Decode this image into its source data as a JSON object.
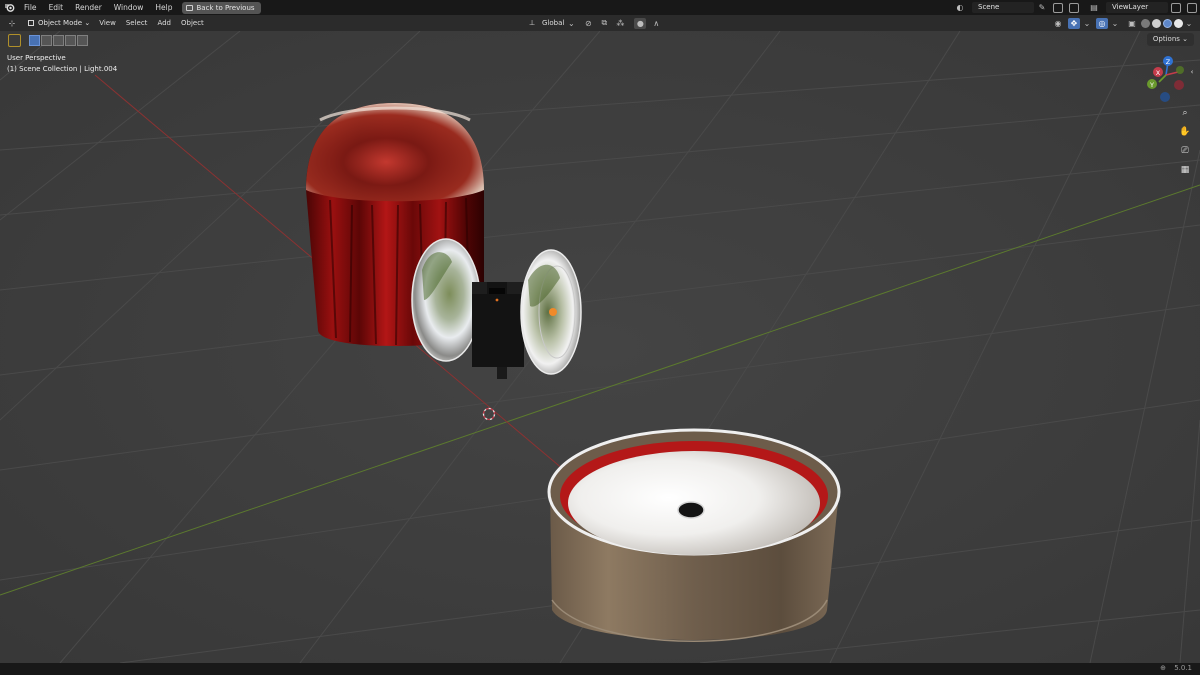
{
  "menu": {
    "file": "File",
    "edit": "Edit",
    "render": "Render",
    "window": "Window",
    "help": "Help",
    "back_to_previous": "Back to Previous"
  },
  "topbar_right": {
    "scene": "Scene",
    "view_layer": "ViewLayer"
  },
  "header": {
    "mode": "Object Mode",
    "view": "View",
    "select": "Select",
    "add": "Add",
    "object": "Object",
    "transform_orientation": "Global",
    "options": "Options"
  },
  "viewport": {
    "perspective_label": "User Perspective",
    "collection_label": "(1) Scene Collection | Light.004",
    "gizmo_axes": {
      "x": "X",
      "y": "Y",
      "z": "Z"
    }
  },
  "status": {
    "version": "5.0.1"
  },
  "icons": [
    "blender-logo",
    "editor-type-icon",
    "object-mode-icon",
    "transform-orientation-icon",
    "snap-icon",
    "proportional-editing-icon",
    "visibility-icon",
    "gizmo-icon",
    "overlay-icon",
    "xray-icon",
    "wireframe-shading-icon",
    "solid-shading-icon",
    "material-shading-icon",
    "rendered-shading-icon",
    "zoom-icon",
    "pan-hand-icon",
    "camera-view-icon",
    "grid-ortho-icon",
    "select-tool-icon"
  ],
  "colors": {
    "accent_blue": "#4872b4",
    "x_axis": "#c43c4b",
    "y_axis": "#6a9a2d",
    "z_axis": "#2f72d3",
    "tool_highlight": "#b0902a"
  }
}
